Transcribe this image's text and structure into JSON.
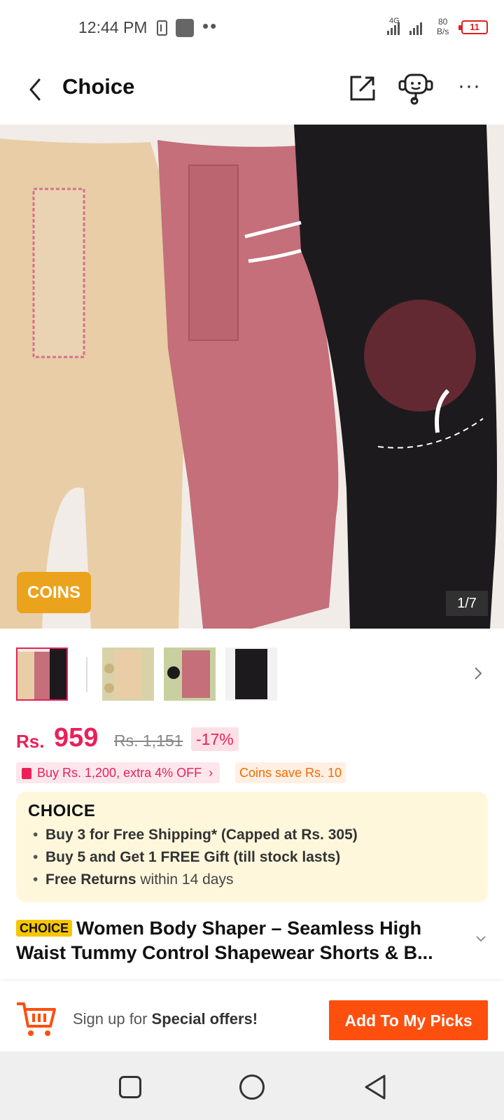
{
  "status_bar": {
    "time": "12:44 PM",
    "network": "4G",
    "speed_value": "80",
    "speed_unit": "B/s",
    "battery": "11"
  },
  "header": {
    "title": "Choice",
    "icons": [
      "back-icon",
      "share-icon",
      "customer-support-icon",
      "more-icon"
    ]
  },
  "gallery": {
    "badge": "COINS",
    "counter": "1/7",
    "thumbnail_count": 4
  },
  "price": {
    "currency": "Rs.",
    "current": "959",
    "original": "Rs. 1,151",
    "discount": "-17%"
  },
  "promos": {
    "bundle": "Buy Rs. 1,200, extra 4% OFF",
    "coins": "Coins save Rs. 10"
  },
  "choice_box": {
    "logo": "CHOICE",
    "benefits": [
      {
        "bold": "Buy 3 for  Free Shipping* (Capped at Rs. 305)",
        "rest": ""
      },
      {
        "bold": "Buy 5 and Get 1 FREE Gift (till stock lasts)",
        "rest": ""
      },
      {
        "bold": "Free Returns",
        "rest": " within 14 days"
      }
    ]
  },
  "product": {
    "badge": "CHOICE",
    "title": "Women Body Shaper – Seamless High Waist Tummy Control Shapewear Shorts & B..."
  },
  "bottom_bar": {
    "signup_prefix": "Sign up for ",
    "signup_bold": "Special offers!",
    "add_button": "Add To My Picks"
  },
  "colors": {
    "accent": "#e8215a",
    "cta": "#fe4f0f",
    "coins_badge": "#eba21c",
    "choice_bg": "#fff7dc"
  }
}
